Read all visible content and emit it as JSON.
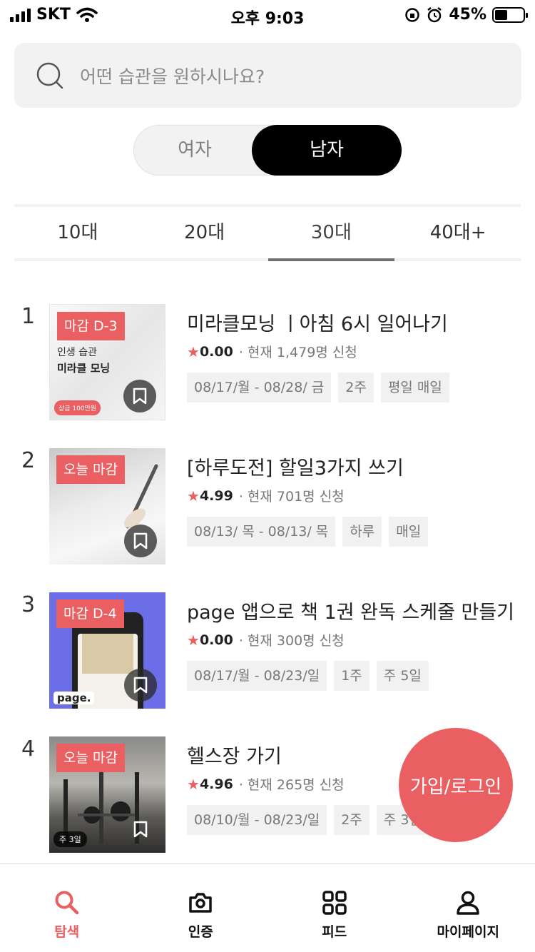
{
  "status_bar": {
    "carrier": "SKT",
    "time": "오후 9:03",
    "battery": "45%",
    "battery_level": 0.45
  },
  "search": {
    "placeholder": "어떤 습관을 원하시나요?"
  },
  "gender": {
    "female": "여자",
    "male": "남자",
    "selected": "male"
  },
  "ages": [
    "10대",
    "20대",
    "30대",
    "40대+"
  ],
  "selected_age": "30대",
  "items": [
    {
      "rank": "1",
      "badge": "마감 D-3",
      "title": "미라클모닝 ㅣ아침 6시 일어나기",
      "rating": "0.00",
      "applicants": "· 현재 1,479명 신청",
      "tags": [
        "08/17/월 - 08/28/ 금",
        "2주",
        "평일 매일"
      ],
      "thumb_line1": "인생 습관",
      "thumb_line2": "미라클 모닝",
      "thumb_pill": "상금 100만원"
    },
    {
      "rank": "2",
      "badge": "오늘 마감",
      "title": "[하루도전] 할일3가지 쓰기",
      "rating": "4.99",
      "applicants": "· 현재 701명 신청",
      "tags": [
        "08/13/ 목 - 08/13/ 목",
        "하루",
        "매일"
      ]
    },
    {
      "rank": "3",
      "badge": "마감 D-4",
      "title": "page 앱으로 책 1권 완독 스케줄 만들기",
      "rating": "0.00",
      "applicants": "· 현재 300명 신청",
      "tags": [
        "08/17/월 - 08/23/일",
        "1주",
        "주 5일"
      ],
      "thumb_logo": "page."
    },
    {
      "rank": "4",
      "badge": "오늘 마감",
      "title": "헬스장 가기",
      "rating": "4.96",
      "applicants": "· 현재 265명 신청",
      "tags": [
        "08/10/월 - 08/23/일",
        "2주",
        "주 3일"
      ],
      "thumb_week": "주 3일"
    }
  ],
  "fab_label": "가입/로그인",
  "nav": [
    {
      "label": "탐색",
      "icon": "search-icon",
      "active": true
    },
    {
      "label": "인증",
      "icon": "camera-icon",
      "active": false
    },
    {
      "label": "피드",
      "icon": "grid-icon",
      "active": false
    },
    {
      "label": "마이페이지",
      "icon": "user-icon",
      "active": false
    }
  ],
  "colors": {
    "accent": "#ea5f61",
    "toggle_active": "#000000"
  }
}
